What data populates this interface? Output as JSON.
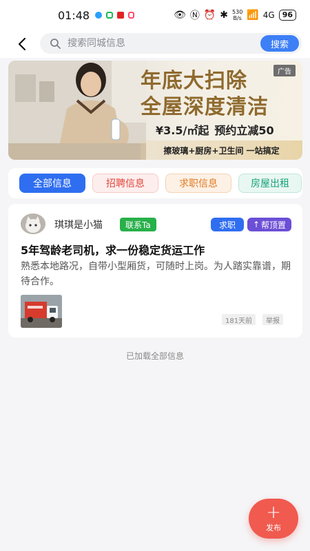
{
  "status_bar": {
    "time": "01:48",
    "net_speed_top": "530",
    "net_speed_bottom": "B/s",
    "network_label": "4G",
    "battery": "96"
  },
  "header": {
    "search_placeholder": "搜索同城信息",
    "search_button": "搜索"
  },
  "banner": {
    "ad_tag": "广告",
    "title_line1": "年底大扫除",
    "title_line2": "全屋深度清洁",
    "price": "¥3.5/㎡起",
    "promo": "预约立减50",
    "subtitle": "擦玻璃+厨房+卫生间 一站搞定"
  },
  "tabs": [
    {
      "label": "全部信息",
      "active": true
    },
    {
      "label": "招聘信息",
      "active": false
    },
    {
      "label": "求职信息",
      "active": false
    },
    {
      "label": "房屋出租",
      "active": false
    }
  ],
  "post": {
    "username": "琪琪是小猫",
    "contact_label": "联系Ta",
    "type_label": "求职",
    "pin_label": "帮顶置",
    "title": "5年驾龄老司机，求一份稳定货运工作",
    "body": "熟悉本地路况，自带小型厢货，可随时上岗。为人踏实靠谱，期待合作。",
    "time": "181天前",
    "report_label": "举报"
  },
  "end_note": "已加载全部信息",
  "fab": {
    "label": "发布"
  },
  "colors": {
    "primary": "#2f6ef0",
    "fab": "#f05a4f",
    "contact": "#28b04a",
    "pin": "#6b4fd6"
  }
}
